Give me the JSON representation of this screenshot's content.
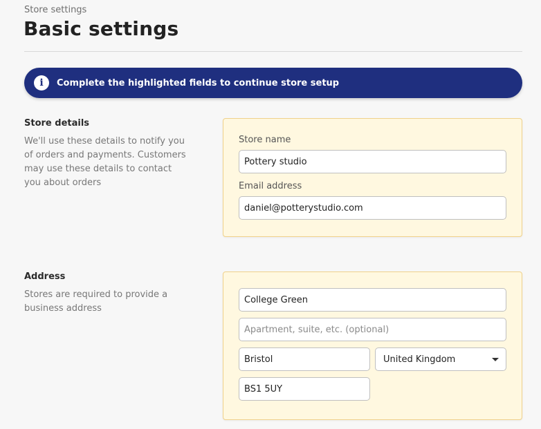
{
  "header": {
    "breadcrumb": "Store settings",
    "title": "Basic settings"
  },
  "banner": {
    "icon": "info-icon",
    "icon_glyph": "i",
    "message": "Complete the highlighted fields to continue store setup",
    "background": "#1f2f7f"
  },
  "store_details": {
    "title": "Store details",
    "description": "We'll use these details to notify you of orders and payments. Customers may use these details to contact you about orders",
    "store_name": {
      "label": "Store name",
      "value": "Pottery studio"
    },
    "email": {
      "label": "Email address",
      "value": "daniel@potterystudio.com"
    }
  },
  "address": {
    "title": "Address",
    "description": "Stores are required to provide a business address",
    "street": {
      "value": "College Green"
    },
    "apartment": {
      "value": "",
      "placeholder": "Apartment, suite, etc. (optional)"
    },
    "city": {
      "value": "Bristol"
    },
    "country": {
      "selected": "United Kingdom",
      "icon": "chevron-down-icon"
    },
    "postcode": {
      "value": "BS1 5UY"
    }
  },
  "colors": {
    "highlight_card": "#fff8e0",
    "highlight_border": "#f0d18a",
    "banner": "#1f2f7f"
  }
}
